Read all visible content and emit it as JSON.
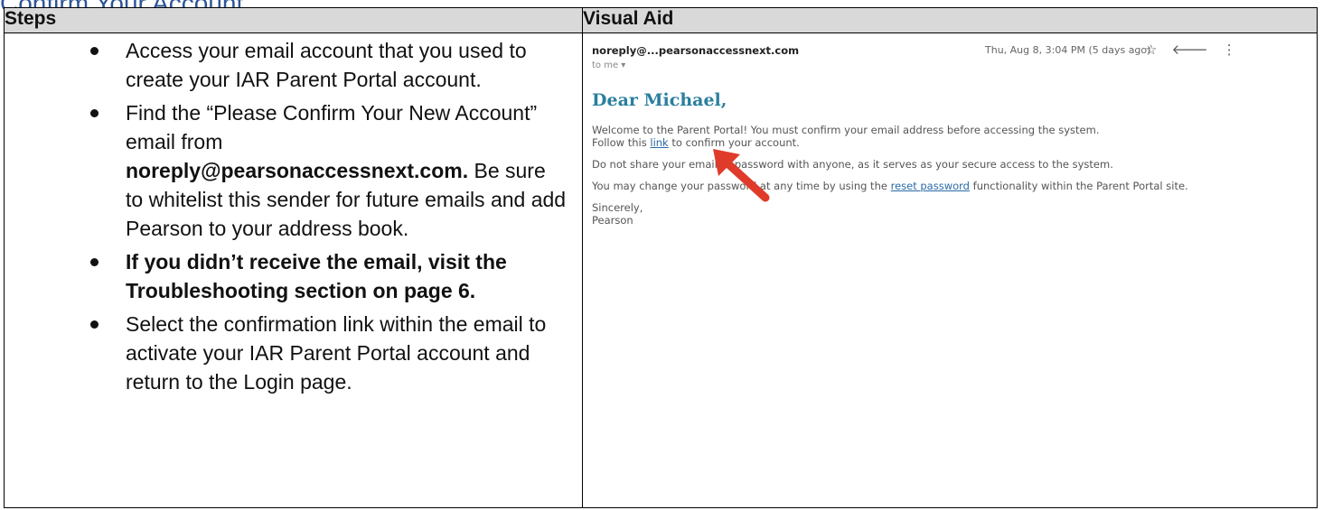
{
  "page_heading": "Confirm Your Account",
  "table": {
    "col_steps": "Steps",
    "col_visual": "Visual Aid"
  },
  "steps": {
    "s1": "Access your email account that you used to create your IAR Parent Portal account.",
    "s2a": "Find the “Please Confirm Your New Account” email from",
    "s2b": "noreply@pearsonaccessnext.com",
    "s2c": ".",
    "s2d": "Be sure to whitelist this sender for future emails and add Pearson to your address book.",
    "s3": "If you didn’t receive the email, visit the Troubleshooting section on page 6.",
    "s4": "Select the confirmation link within the email to activate your IAR Parent Portal account and return to the Login page."
  },
  "email": {
    "from": "noreply@...pearsonaccessnext.com",
    "to": "to me ▾",
    "date": "Thu, Aug 8, 3:04 PM (5 days ago)",
    "icons": [
      "star-icon",
      "reply-icon",
      "more-vert-icon"
    ],
    "greeting": "Dear Michael,",
    "p1a": "Welcome to the Parent Portal! You must confirm your email address before accessing the system.",
    "p1b": "Follow this",
    "p1_link": "link",
    "p1c": "to confirm your account.",
    "p2": "Do not share your email or password with anyone, as it serves as your secure access to the system.",
    "p3a": "You may change your password at any time by using the",
    "p3_link": "reset password",
    "p3b": "functionality within the Parent Portal site.",
    "closing": "Sincerely,",
    "signature": "Pearson",
    "arrow_color": "#e03b2a"
  }
}
